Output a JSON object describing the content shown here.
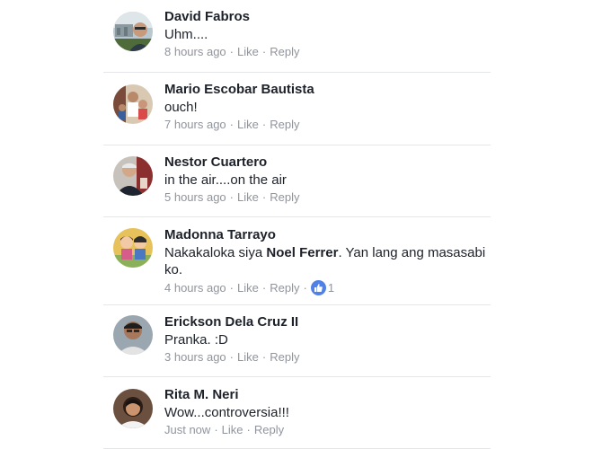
{
  "comments": [
    {
      "author": "David Fabros",
      "text": "Uhm....",
      "time": "8 hours ago",
      "like": "Like",
      "reply": "Reply",
      "avatar": "avatar-david-fabros"
    },
    {
      "author": "Mario Escobar Bautista",
      "text": "ouch!",
      "time": "7 hours ago",
      "like": "Like",
      "reply": "Reply",
      "avatar": "avatar-mario-escobar-bautista"
    },
    {
      "author": "Nestor Cuartero",
      "text": "in the air....on the air",
      "time": "5 hours ago",
      "like": "Like",
      "reply": "Reply",
      "avatar": "avatar-nestor-cuartero"
    },
    {
      "author": "Madonna Tarrayo",
      "text_before": "Nakakaloka siya ",
      "mention": "Noel Ferrer",
      "text_after": ".  Yan lang ang masasabi ko.",
      "time": "4 hours ago",
      "like": "Like",
      "reply": "Reply",
      "reaction_icon": "thumbs-up-icon",
      "reaction_count": "1",
      "avatar": "avatar-madonna-tarrayo"
    },
    {
      "author": "Erickson Dela Cruz II",
      "text": "Pranka.  :D",
      "time": "3 hours ago",
      "like": "Like",
      "reply": "Reply",
      "avatar": "avatar-erickson-dela-cruz"
    },
    {
      "author": "Rita M. Neri",
      "text": "Wow...controversia!!!",
      "time": "Just now",
      "like": "Like",
      "reply": "Reply",
      "avatar": "avatar-rita-neri"
    }
  ],
  "colors": {
    "author": "#1d2129",
    "meta": "#90949c",
    "divider": "#e5e6e9",
    "reaction": "#4f81e8"
  }
}
